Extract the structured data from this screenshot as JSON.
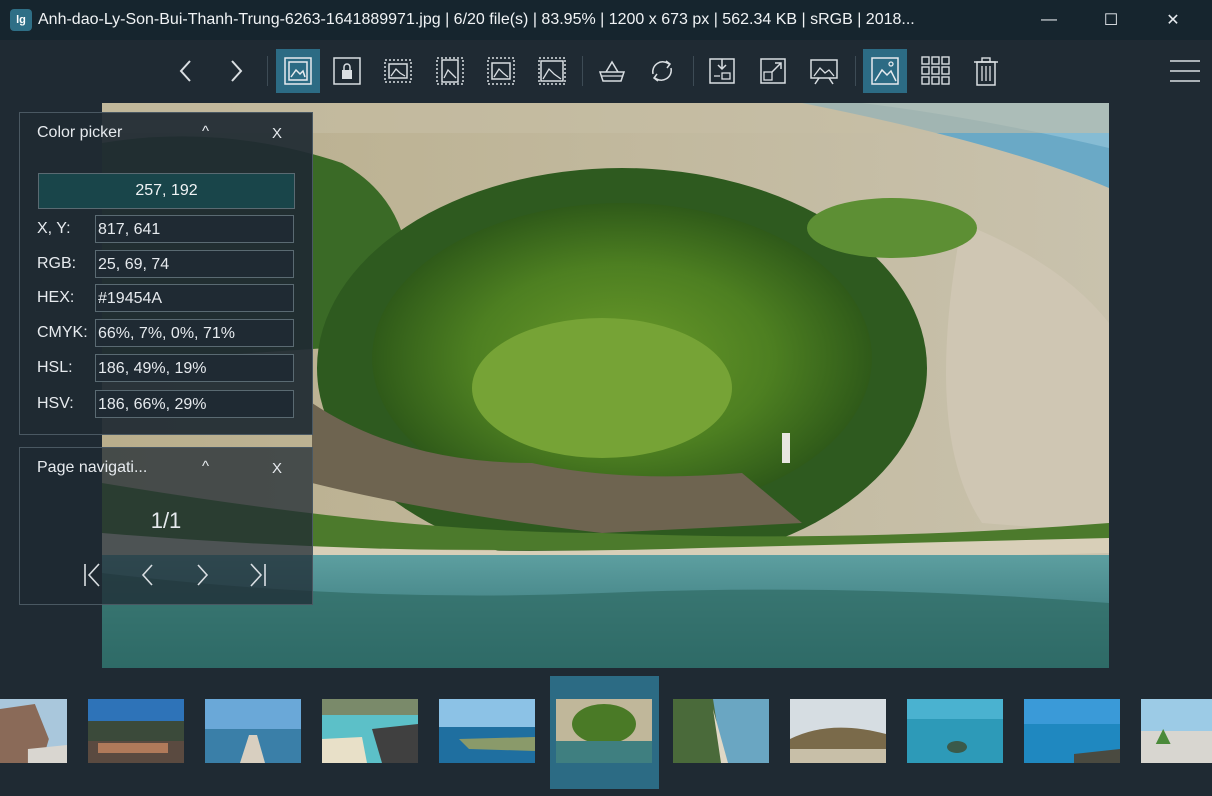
{
  "window": {
    "title": "Anh-dao-Ly-Son-Bui-Thanh-Trung-6263-1641889971.jpg  |  6/20 file(s)  |  83.95%  |  1200 x 673 px  |  562.34 KB  |  sRGB  |  2018...",
    "logo_text": "lg",
    "min_glyph": "—",
    "max_glyph": "☐",
    "close_glyph": "✕"
  },
  "toolbar": {
    "buttons": [
      {
        "name": "previous-image-icon",
        "active": false
      },
      {
        "name": "next-image-icon",
        "active": false
      },
      {
        "name": "auto-zoom-icon",
        "active": true
      },
      {
        "name": "lock-zoom-icon",
        "active": false
      },
      {
        "name": "scale-to-width-icon",
        "active": false
      },
      {
        "name": "scale-to-height-icon",
        "active": false
      },
      {
        "name": "scale-to-fit-icon",
        "active": false
      },
      {
        "name": "scale-to-fill-icon",
        "active": false
      },
      {
        "name": "checkerboard-background-icon",
        "active": false
      },
      {
        "name": "rotate-icon",
        "active": false
      },
      {
        "name": "crop-icon",
        "active": false
      },
      {
        "name": "fullscreen-icon",
        "active": false
      },
      {
        "name": "slideshow-icon",
        "active": false
      },
      {
        "name": "thumbnail-bar-icon",
        "active": true
      },
      {
        "name": "gallery-grid-icon",
        "active": false
      },
      {
        "name": "delete-icon",
        "active": false
      },
      {
        "name": "main-menu-icon",
        "active": false
      }
    ]
  },
  "color_picker": {
    "title": "Color picker",
    "collapse_glyph": "^",
    "close_glyph": "X",
    "swatch_label": "257, 192",
    "swatch_color": "#19454A",
    "rows": [
      {
        "label": "X, Y:",
        "value": "817, 641"
      },
      {
        "label": "RGB:",
        "value": "25, 69, 74"
      },
      {
        "label": "HEX:",
        "value": "#19454A"
      },
      {
        "label": "CMYK:",
        "value": "66%, 7%, 0%, 71%"
      },
      {
        "label": "HSL:",
        "value": "186, 49%, 19%"
      },
      {
        "label": "HSV:",
        "value": "186, 66%, 29%"
      }
    ]
  },
  "page_nav": {
    "title": "Page navigati...",
    "collapse_glyph": "^",
    "close_glyph": "X",
    "indicator": "1/1"
  },
  "thumbnails": {
    "count": 11,
    "selected_index": 5
  },
  "colors": {
    "accent": "#2c6b84",
    "background": "#1f2a33",
    "titlebar": "#16252e"
  }
}
